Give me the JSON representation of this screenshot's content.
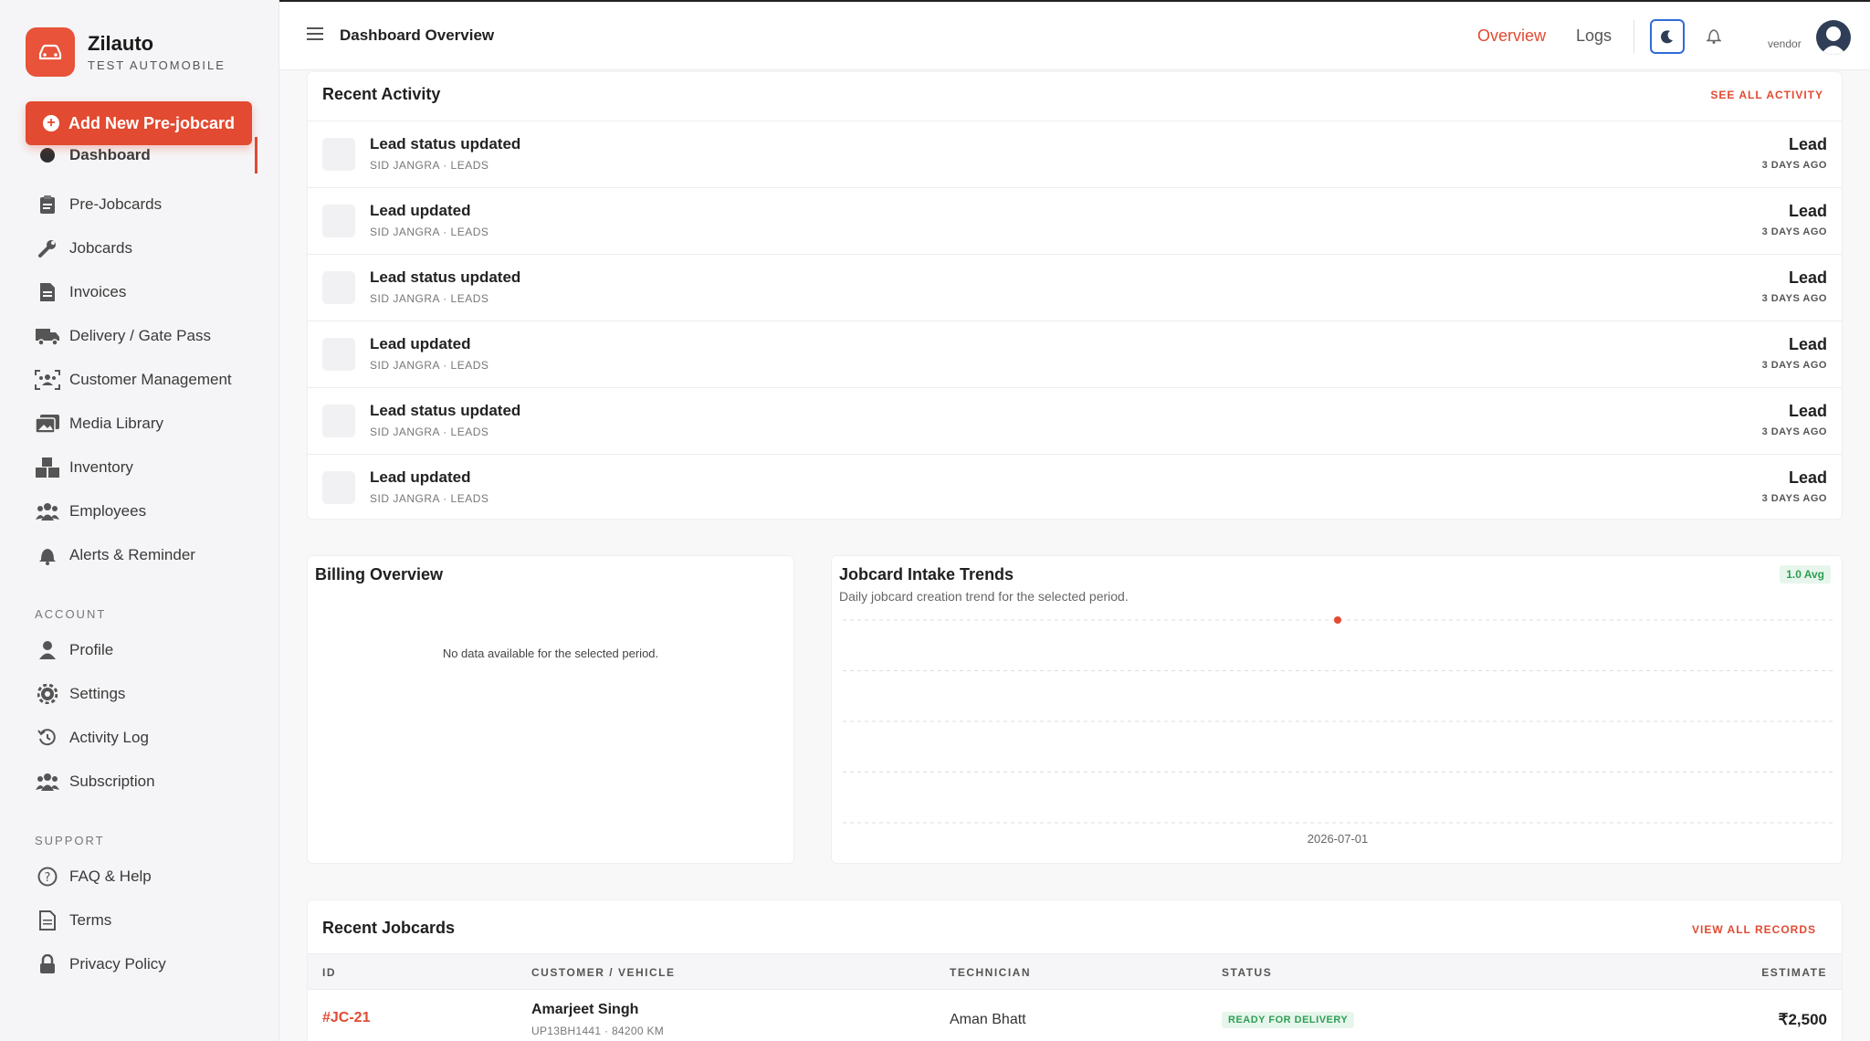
{
  "brand": {
    "name": "Zilauto",
    "subtitle": "TEST AUTOMOBILE"
  },
  "sidebar": {
    "add_button": "Add New Pre-jobcard",
    "active_item": "Dashboard",
    "items": [
      {
        "label": "Pre-Jobcards",
        "icon": "clipboard-icon"
      },
      {
        "label": "Jobcards",
        "icon": "wrench-icon"
      },
      {
        "label": "Invoices",
        "icon": "invoice-icon"
      },
      {
        "label": "Delivery / Gate Pass",
        "icon": "truck-icon"
      },
      {
        "label": "Customer Management",
        "icon": "users-icon"
      },
      {
        "label": "Media Library",
        "icon": "images-icon"
      },
      {
        "label": "Inventory",
        "icon": "boxes-icon"
      },
      {
        "label": "Employees",
        "icon": "people-icon"
      },
      {
        "label": "Alerts & Reminder",
        "icon": "bell-icon"
      }
    ],
    "account_title": "ACCOUNT",
    "account_items": [
      {
        "label": "Profile",
        "icon": "user-icon"
      },
      {
        "label": "Settings",
        "icon": "gear-icon"
      },
      {
        "label": "Activity Log",
        "icon": "history-icon"
      },
      {
        "label": "Subscription",
        "icon": "team-icon"
      }
    ],
    "support_title": "SUPPORT",
    "support_items": [
      {
        "label": "FAQ & Help",
        "icon": "help-icon"
      },
      {
        "label": "Terms",
        "icon": "document-icon"
      },
      {
        "label": "Privacy Policy",
        "icon": "lock-icon"
      }
    ]
  },
  "header": {
    "title": "Dashboard Overview",
    "tabs": [
      "Overview",
      "Logs"
    ],
    "user_role": "vendor"
  },
  "activity": {
    "title": "Recent Activity",
    "link": "SEE ALL ACTIVITY",
    "rows": [
      {
        "title": "Lead status updated",
        "sub": "SID JANGRA · LEADS",
        "type": "Lead",
        "time": "3 DAYS AGO"
      },
      {
        "title": "Lead updated",
        "sub": "SID JANGRA · LEADS",
        "type": "Lead",
        "time": "3 DAYS AGO"
      },
      {
        "title": "Lead status updated",
        "sub": "SID JANGRA · LEADS",
        "type": "Lead",
        "time": "3 DAYS AGO"
      },
      {
        "title": "Lead updated",
        "sub": "SID JANGRA · LEADS",
        "type": "Lead",
        "time": "3 DAYS AGO"
      },
      {
        "title": "Lead status updated",
        "sub": "SID JANGRA · LEADS",
        "type": "Lead",
        "time": "3 DAYS AGO"
      },
      {
        "title": "Lead updated",
        "sub": "SID JANGRA · LEADS",
        "type": "Lead",
        "time": "3 DAYS AGO"
      }
    ]
  },
  "billing": {
    "title": "Billing Overview",
    "empty": "No data available for the selected period."
  },
  "trends": {
    "title": "Jobcard Intake Trends",
    "subtitle": "Daily jobcard creation trend for the selected period.",
    "badge": "1.0 Avg"
  },
  "chart_data": {
    "type": "line",
    "title": "Jobcard Intake Trends",
    "x": [
      "2026-07-01"
    ],
    "series": [
      {
        "values": [
          1
        ]
      }
    ],
    "grid": true,
    "point_color": "#e24a31"
  },
  "jobcards": {
    "title": "Recent Jobcards",
    "link": "VIEW ALL RECORDS",
    "columns": [
      "ID",
      "CUSTOMER / VEHICLE",
      "TECHNICIAN",
      "STATUS",
      "ESTIMATE"
    ],
    "rows": [
      {
        "id": "#JC-21",
        "customer": "Amarjeet Singh",
        "vehicle": "UP13BH1441 · 84200 KM",
        "technician": "Aman Bhatt",
        "status": "READY FOR DELIVERY",
        "estimate": "₹2,500"
      }
    ]
  },
  "colors": {
    "accent": "#e24a31",
    "success": "#2e9e55",
    "focus": "#2f6bd6"
  }
}
